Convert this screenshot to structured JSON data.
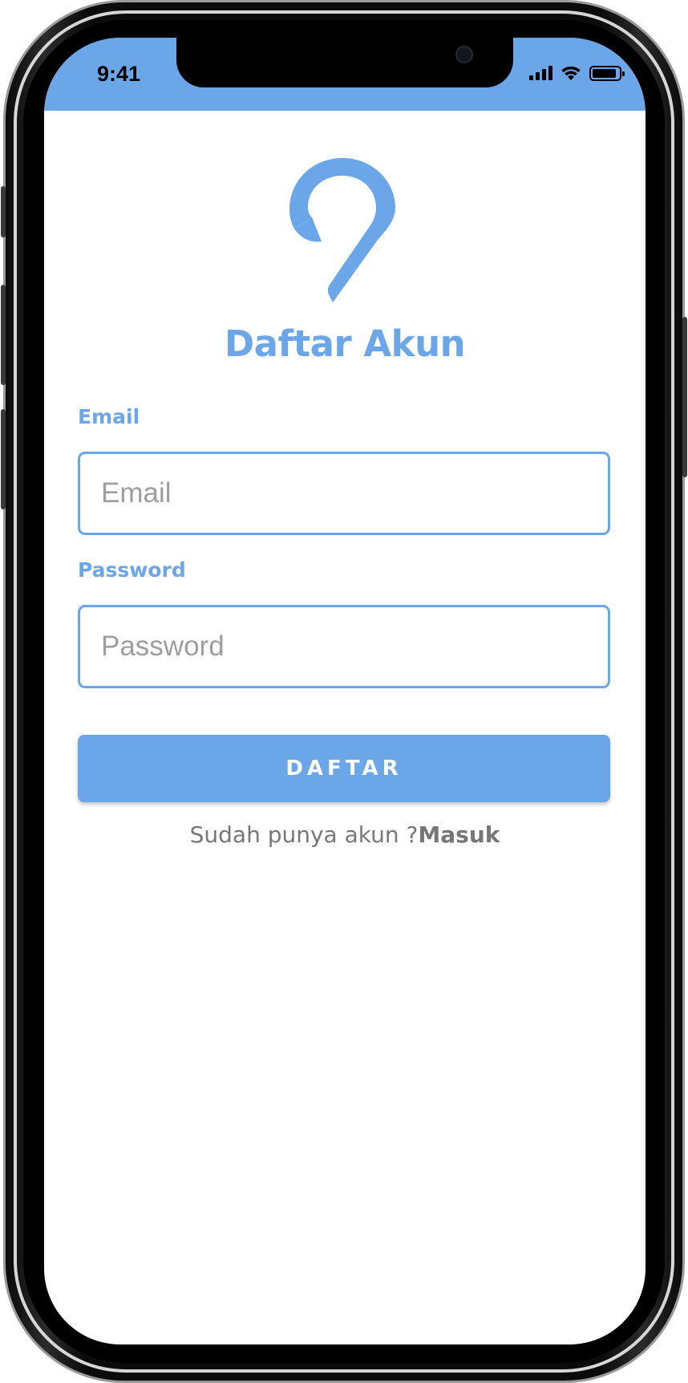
{
  "status_bar": {
    "time": "9:41",
    "battery_level": 0.9
  },
  "colors": {
    "primary": "#6aa6e8",
    "muted_text": "#777777"
  },
  "logo": {
    "icon": "location-pin-icon"
  },
  "page": {
    "title": "Daftar Akun"
  },
  "form": {
    "email": {
      "label": "Email",
      "placeholder": "Email",
      "value": ""
    },
    "password": {
      "label": "Password",
      "placeholder": "Password",
      "value": ""
    },
    "submit_label": "DAFTAR"
  },
  "footer": {
    "prompt": "Sudah punya akun ?",
    "link_label": "Masuk"
  }
}
